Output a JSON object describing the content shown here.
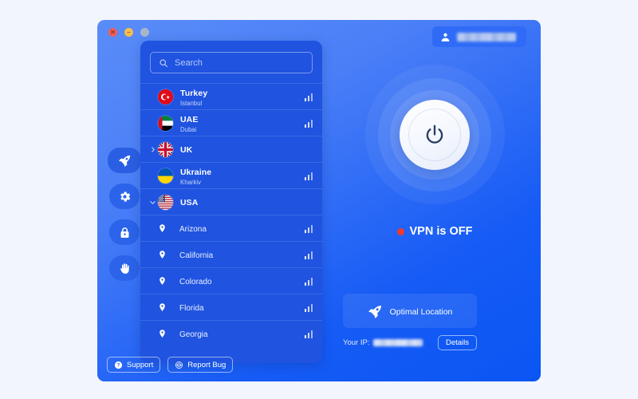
{
  "window": {
    "traffic_lights": [
      {
        "name": "close",
        "glyph": "✕",
        "color": "#ef5f56"
      },
      {
        "name": "minimize",
        "glyph": "–",
        "color": "#f5bd4f"
      },
      {
        "name": "maximize",
        "glyph": "",
        "color": "#a8b6cc"
      }
    ]
  },
  "account": {
    "icon": "person-icon",
    "username_redacted": true
  },
  "rail": {
    "items": [
      {
        "name": "vpn",
        "icon": "rocket-icon",
        "active": true
      },
      {
        "name": "settings",
        "icon": "gear-icon",
        "active": false
      },
      {
        "name": "security",
        "icon": "lock-icon",
        "active": false
      },
      {
        "name": "privacy",
        "icon": "hand-icon",
        "active": false
      }
    ]
  },
  "search": {
    "icon": "search-icon",
    "placeholder": "Search",
    "value": ""
  },
  "countries": [
    {
      "name": "Turkey",
      "city": "Istanbul",
      "flag": "tr",
      "expandable": false,
      "expanded": false,
      "signal": 3
    },
    {
      "name": "UAE",
      "city": "Dubai",
      "flag": "ae",
      "expandable": false,
      "expanded": false,
      "signal": 3
    },
    {
      "name": "UK",
      "city": "",
      "flag": "gb",
      "expandable": true,
      "expanded": false,
      "signal": 0
    },
    {
      "name": "Ukraine",
      "city": "Kharkiv",
      "flag": "ua",
      "expandable": false,
      "expanded": false,
      "signal": 3
    },
    {
      "name": "USA",
      "city": "",
      "flag": "us",
      "expandable": true,
      "expanded": true,
      "signal": 0
    }
  ],
  "usa_cities": [
    {
      "name": "Arizona",
      "icon": "location-pin-icon",
      "signal": 3
    },
    {
      "name": "California",
      "icon": "location-pin-icon",
      "signal": 3
    },
    {
      "name": "Colorado",
      "icon": "location-pin-icon",
      "signal": 3
    },
    {
      "name": "Florida",
      "icon": "location-pin-icon",
      "signal": 3
    },
    {
      "name": "Georgia",
      "icon": "location-pin-icon",
      "signal": 3
    }
  ],
  "power": {
    "icon": "power-icon",
    "state": "off"
  },
  "status": {
    "text": "VPN is OFF",
    "dot_color": "#ef3b2d"
  },
  "optimal_location": {
    "icon": "rocket-icon",
    "label": "Optimal Location"
  },
  "ip": {
    "label": "Your IP:",
    "value_redacted": true,
    "details_label": "Details"
  },
  "footer": {
    "buttons": [
      {
        "name": "support",
        "icon": "question-circle-icon",
        "label": "Support"
      },
      {
        "name": "report-bug",
        "icon": "bug-icon",
        "label": "Report Bug"
      }
    ]
  },
  "colors": {
    "accent": "#1f53e0",
    "window_blue": "#0a56f4",
    "panel_blue": "#1f53e0",
    "status_red": "#ef3b2d",
    "page_bg": "#f2f5fc"
  }
}
